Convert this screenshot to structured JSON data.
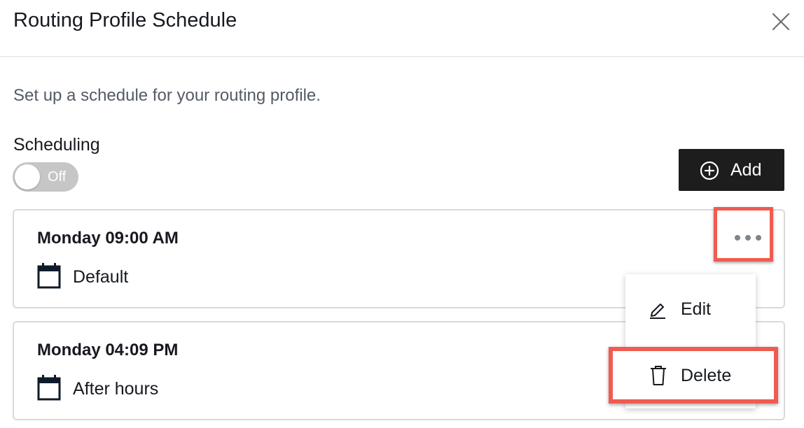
{
  "modal": {
    "title": "Routing Profile Schedule",
    "subtitle": "Set up a schedule for your routing profile."
  },
  "scheduling": {
    "label": "Scheduling",
    "toggle_text": "Off",
    "enabled": false
  },
  "add_button": {
    "label": "Add"
  },
  "schedules": [
    {
      "time": "Monday 09:00 AM",
      "name": "Default"
    },
    {
      "time": "Monday 04:09 PM",
      "name": "After hours"
    }
  ],
  "actions_menu": {
    "edit_label": "Edit",
    "delete_label": "Delete"
  },
  "colors": {
    "highlight": "#f15b4f",
    "button_bg": "#1d1d1d",
    "toggle_off": "#c6c6c6",
    "icon_dark": "#0f1b2a"
  }
}
